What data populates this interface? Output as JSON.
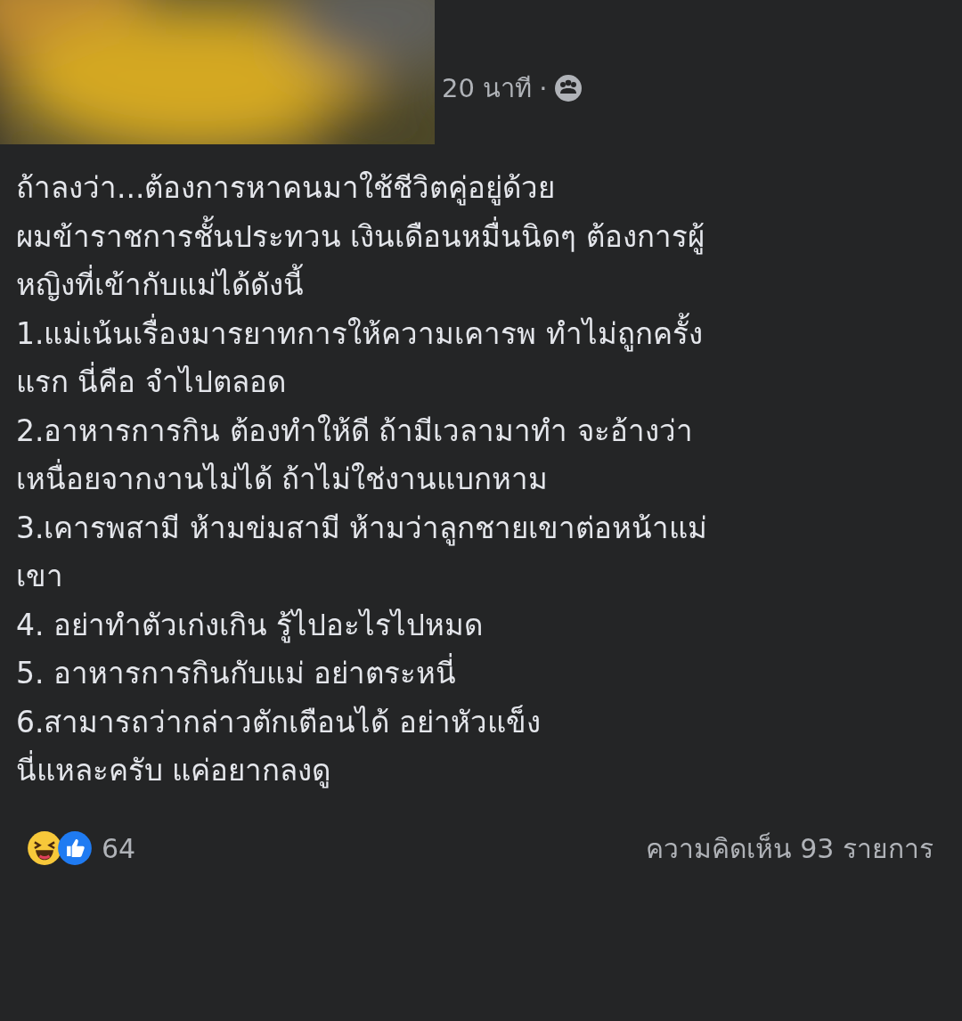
{
  "post": {
    "time": "20 นาที",
    "separator": "·",
    "lines": [
      "ถ้าลงว่า...ต้องการหาคนมาใช้ชีวิตคู่อยู่ด้วย",
      "ผมข้าราชการชั้นประทวน เงินเดือนหมื่นนิดๆ ต้องการผู้",
      "หญิงที่เข้ากับแม่ได้ดังนี้",
      "1.แม่เน้นเรื่องมารยาทการให้ความเคารพ ทำไม่ถูกครั้ง",
      "แรก นี่คือ จำไปตลอด",
      "2.อาหารการกิน ต้องทำให้ดี  ถ้ามีเวลามาทำ จะอ้างว่า",
      "เหนื่อยจากงานไม่ได้ ถ้าไม่ใช่งานแบกหาม",
      "3.เคารพสามี ห้ามข่มสามี ห้ามว่าลูกชายเขาต่อหน้าแม่",
      "เขา",
      "4. อย่าทำตัวเก่งเกิน รู้ไปอะไรไปหมด",
      "5. อาหารการกินกับแม่ อย่าตระหนี่",
      "6.สามารถว่ากล่าวตักเตือนได้ อย่าหัวแข็ง",
      "นี่แหละครับ แค่อยากลงดู"
    ],
    "reaction_count": "64",
    "comments": "ความคิดเห็น 93 รายการ"
  }
}
